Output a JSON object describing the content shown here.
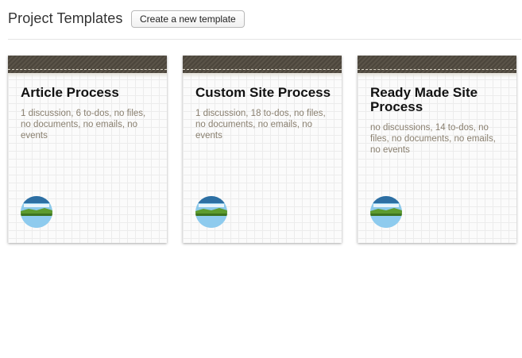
{
  "header": {
    "title": "Project Templates",
    "create_button_label": "Create a new template"
  },
  "templates": [
    {
      "title": "Article Process",
      "summary": "1 discussion, 6 to-dos, no files, no documents, no emails, no events",
      "avatar_icon": "landscape-avatar-icon"
    },
    {
      "title": "Custom Site Process",
      "summary": "1 discussion, 18 to-dos, no files, no documents, no emails, no events",
      "avatar_icon": "landscape-avatar-icon"
    },
    {
      "title": "Ready Made Site Process",
      "summary": "no discussions, 14 to-dos, no files, no documents, no emails, no events",
      "avatar_icon": "landscape-avatar-icon"
    }
  ],
  "colors": {
    "binding": "#544d43",
    "desc_text": "#8a8070",
    "avatar_sky": "#6ab6df",
    "avatar_land": "#5d9b2e"
  }
}
